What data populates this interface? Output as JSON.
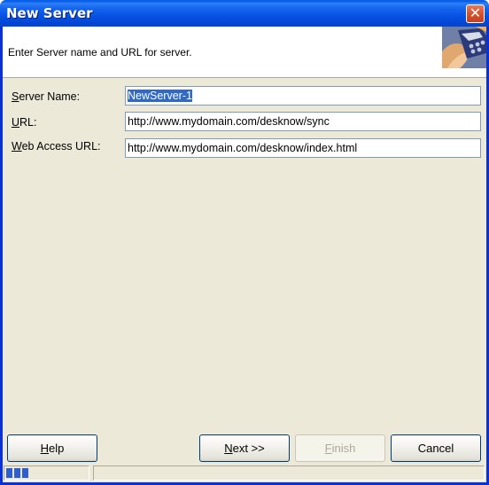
{
  "window": {
    "title": "New Server",
    "close_glyph": "✕"
  },
  "header": {
    "instruction": "Enter Server name and URL for server.",
    "graphic_icon": "wizard-header-graphic"
  },
  "form": {
    "server_name": {
      "label": "Server Name:",
      "mnemonic": "S",
      "label_rest": "erver Name:",
      "value": "NewServer-1"
    },
    "url": {
      "label": "URL:",
      "mnemonic": "U",
      "label_rest": "RL:",
      "value": "http://www.mydomain.com/desknow/sync"
    },
    "web_access_url": {
      "label": "Web Access URL:",
      "mnemonic": "W",
      "label_rest": "eb Access URL:",
      "value": "http://www.mydomain.com/desknow/index.html"
    }
  },
  "buttons": {
    "help": {
      "mnemonic": "H",
      "rest": "elp",
      "label": "Help"
    },
    "next": {
      "mnemonic": "N",
      "rest": "ext >>",
      "label": "Next >>"
    },
    "finish": {
      "mnemonic": "F",
      "rest": "inish",
      "label": "Finish"
    },
    "cancel": {
      "label": "Cancel"
    }
  },
  "status": {
    "progress_blocks": 3
  },
  "colors": {
    "title_bar": "#0a5fe9",
    "dialog_bg": "#ece9d8",
    "selection": "#316ac5"
  }
}
